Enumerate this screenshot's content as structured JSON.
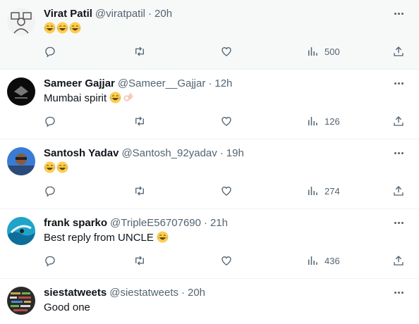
{
  "tweets": [
    {
      "name": "Virat Patil",
      "handle": "@viratpatil",
      "sep": "·",
      "time": "20h",
      "text": "",
      "emojis": [
        "laugh",
        "laugh",
        "laugh"
      ],
      "views": "500",
      "avatar": "robot-icon"
    },
    {
      "name": "Sameer Gajjar",
      "handle": "@Sameer__Gajjar",
      "sep": "·",
      "time": "12h",
      "text": "Mumbai spirit ",
      "emojis": [
        "laugh",
        "ok-hand"
      ],
      "views": "126",
      "avatar": "dark-logo"
    },
    {
      "name": "Santosh Yadav",
      "handle": "@Santosh_92yadav",
      "sep": "·",
      "time": "19h",
      "text": "",
      "emojis": [
        "laugh",
        "laugh"
      ],
      "views": "274",
      "avatar": "person-photo"
    },
    {
      "name": "frank sparko",
      "handle": "@TripleE56707690",
      "sep": "·",
      "time": "21h",
      "text": "Best reply from UNCLE ",
      "emojis": [
        "laugh"
      ],
      "views": "436",
      "avatar": "surfer-photo"
    },
    {
      "name": "siestatweets",
      "handle": "@siestatweets",
      "sep": "·",
      "time": "20h",
      "text": "Good one",
      "emojis": [],
      "views": "",
      "avatar": "word-cloud"
    }
  ],
  "colors": {
    "muted": "#536471",
    "text": "#0f1419",
    "highlight": "#f7f9f9",
    "divider": "#eff3f4",
    "emoji": "#ffcc4d"
  }
}
